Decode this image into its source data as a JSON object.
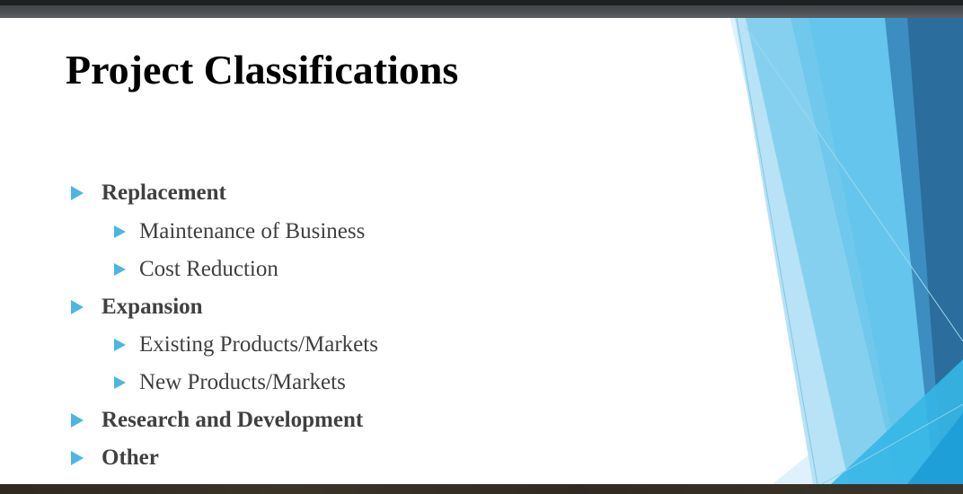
{
  "slide": {
    "title": "Project Classifications",
    "bullets": [
      {
        "level": 1,
        "text": "Replacement"
      },
      {
        "level": 2,
        "text": "Maintenance of Business"
      },
      {
        "level": 2,
        "text": "Cost Reduction"
      },
      {
        "level": 1,
        "text": "Expansion"
      },
      {
        "level": 2,
        "text": "Existing Products/Markets"
      },
      {
        "level": 2,
        "text": "New Products/Markets"
      },
      {
        "level": 1,
        "text": "Research and Development"
      },
      {
        "level": 1,
        "text": "Other"
      }
    ]
  },
  "theme": {
    "accent": "#4cb6e2",
    "accent_dark": "#2b6d9c",
    "text": "#404040",
    "title": "#000000"
  },
  "icons": {
    "bullet": "triangle-right-icon"
  }
}
